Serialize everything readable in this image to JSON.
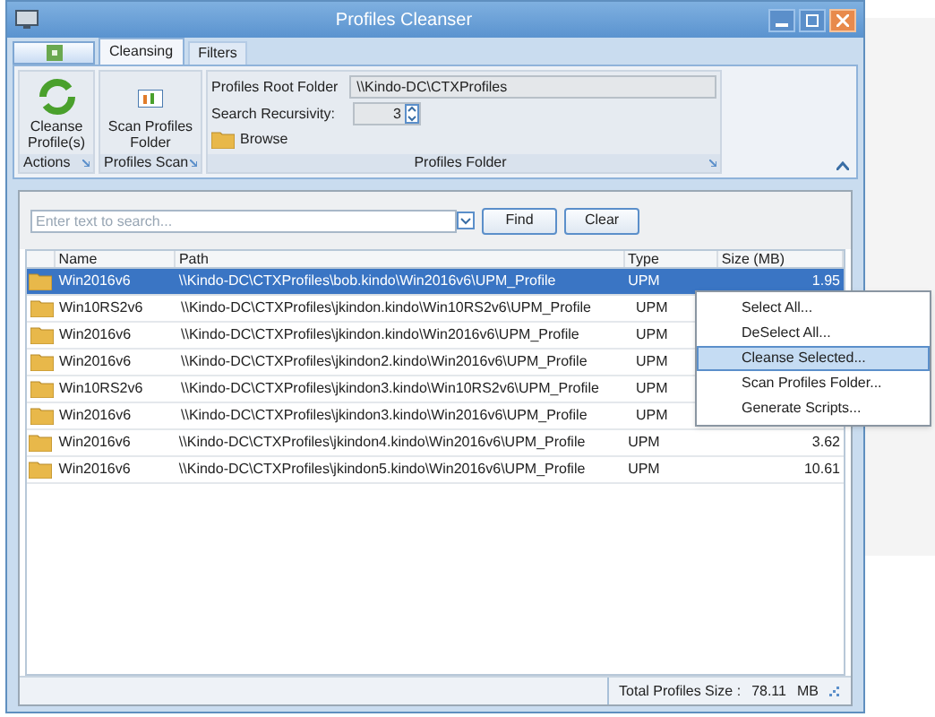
{
  "window": {
    "title": "Profiles Cleanser"
  },
  "tabs": [
    {
      "label": "Cleansing",
      "selected": true
    },
    {
      "label": "Filters",
      "selected": false
    }
  ],
  "ribbon": {
    "groups": [
      {
        "label": "Actions",
        "buttons": [
          "Cleanse Profile(s)"
        ]
      },
      {
        "label": "Profiles Scan",
        "buttons": [
          "Scan Profiles Folder"
        ]
      }
    ],
    "folder_group": {
      "label": "Profiles Folder",
      "root_label": "Profiles Root Folder",
      "root_value": "\\\\Kindo-DC\\CTXProfiles",
      "recursivity_label": "Search Recursivity:",
      "recursivity_value": "3",
      "browse": "Browse"
    }
  },
  "search": {
    "placeholder": "Enter text to search...",
    "buttons": [
      "Find",
      "Clear"
    ]
  },
  "table": {
    "columns": [
      "Name",
      "Path",
      "Type",
      "Size (MB)"
    ],
    "rows": [
      {
        "selected": true,
        "cells": [
          "Win2016v6",
          "\\\\Kindo-DC\\CTXProfiles\\bob.kindo\\Win2016v6\\UPM_Profile",
          "UPM",
          "1.95"
        ]
      },
      {
        "selected": false,
        "cells": [
          "Win10RS2v6",
          "\\\\Kindo-DC\\CTXProfiles\\jkindon.kindo\\Win10RS2v6\\UPM_Profile",
          "UPM"
        ]
      },
      {
        "selected": false,
        "cells": [
          "Win2016v6",
          "\\\\Kindo-DC\\CTXProfiles\\jkindon.kindo\\Win2016v6\\UPM_Profile",
          "UPM"
        ]
      },
      {
        "selected": false,
        "cells": [
          "Win2016v6",
          "\\\\Kindo-DC\\CTXProfiles\\jkindon2.kindo\\Win2016v6\\UPM_Profile",
          "UPM"
        ]
      },
      {
        "selected": false,
        "cells": [
          "Win10RS2v6",
          "\\\\Kindo-DC\\CTXProfiles\\jkindon3.kindo\\Win10RS2v6\\UPM_Profile",
          "UPM"
        ]
      },
      {
        "selected": false,
        "cells": [
          "Win2016v6",
          "\\\\Kindo-DC\\CTXProfiles\\jkindon3.kindo\\Win2016v6\\UPM_Profile",
          "UPM"
        ]
      },
      {
        "selected": false,
        "cells": [
          "Win2016v6",
          "\\\\Kindo-DC\\CTXProfiles\\jkindon4.kindo\\Win2016v6\\UPM_Profile",
          "UPM",
          "3.62"
        ]
      },
      {
        "selected": false,
        "cells": [
          "Win2016v6",
          "\\\\Kindo-DC\\CTXProfiles\\jkindon5.kindo\\Win2016v6\\UPM_Profile",
          "UPM",
          "10.61"
        ]
      }
    ]
  },
  "context_menu": [
    {
      "label": "Select All...",
      "selected": false
    },
    {
      "label": "DeSelect All...",
      "selected": false
    },
    {
      "label": "Cleanse Selected...",
      "selected": true
    },
    {
      "label": "Scan Profiles Folder...",
      "selected": false
    },
    {
      "label": "Generate Scripts...",
      "selected": false
    }
  ],
  "status_bar": {
    "label": "Total Profiles Size :",
    "value": "78.11",
    "unit": "MB"
  }
}
